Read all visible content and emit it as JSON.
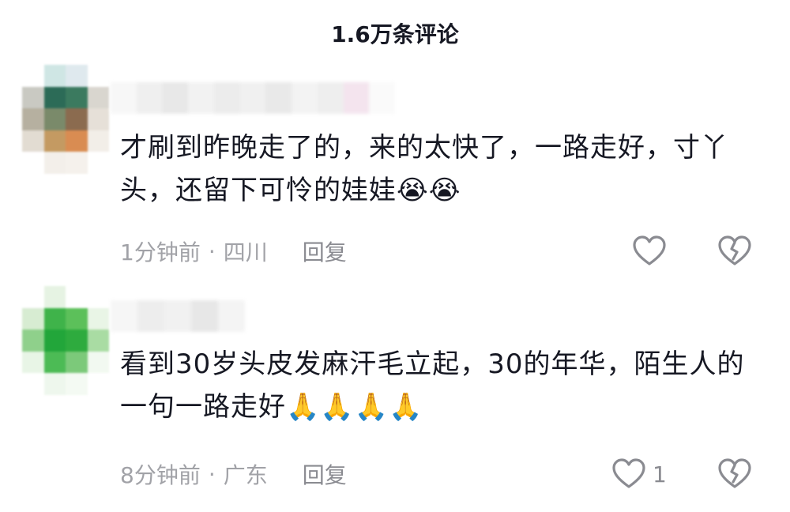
{
  "header": {
    "title": "1.6万条评论"
  },
  "comments": [
    {
      "text": "才刷到昨晚走了的，来的太快了，一路走好，寸丫头，还留下可怜的娃娃",
      "emojis": "😭😭",
      "time": "1分钟前",
      "location": "四川",
      "reply_label": "回复",
      "like_count": ""
    },
    {
      "text": "看到30岁头皮发麻汗毛立起，30的年华，陌生人的一句一路走好",
      "emojis": "🙏🙏🙏🙏",
      "time": "8分钟前",
      "location": "广东",
      "reply_label": "回复",
      "like_count": "1"
    }
  ],
  "separator": "·",
  "colors": {
    "text": "#161823",
    "meta": "#a1a2a7",
    "icon": "#8a8b91",
    "background": "#ffffff"
  }
}
